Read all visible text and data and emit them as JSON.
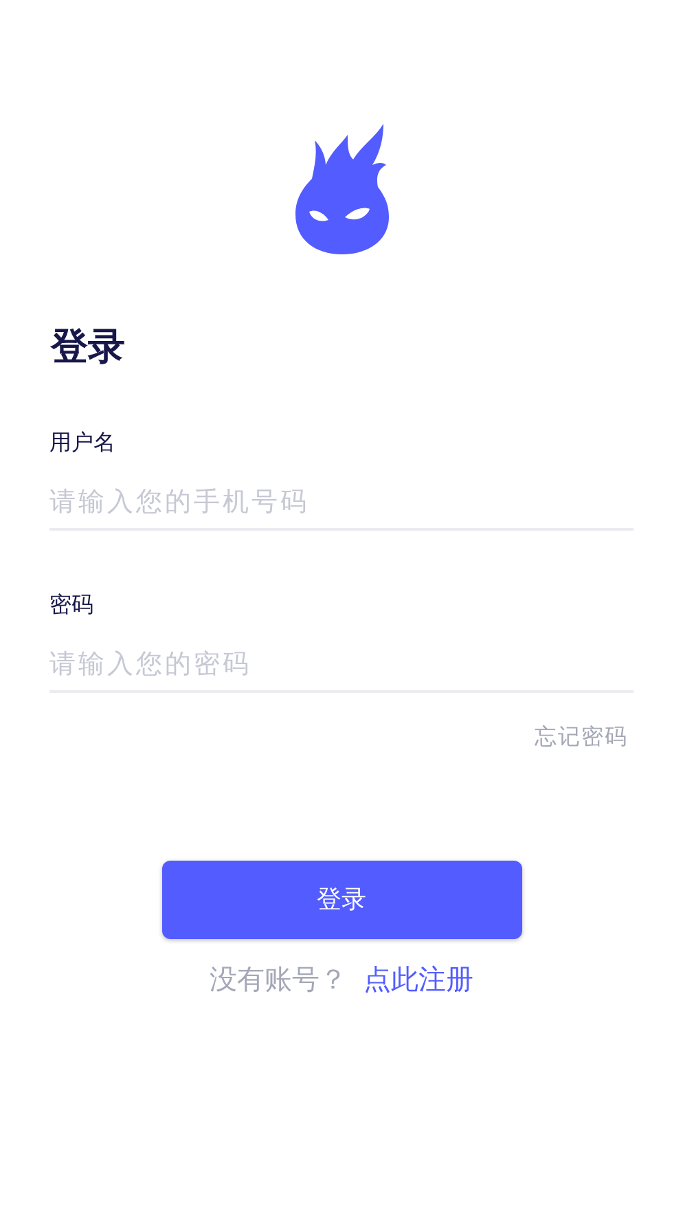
{
  "title": "登录",
  "fields": [
    {
      "label": "用户名",
      "placeholder": "请输入您的手机号码"
    },
    {
      "label": "密码",
      "placeholder": "请输入您的密码"
    }
  ],
  "forgot_link": "忘记密码",
  "login_button": "登录",
  "signup_prompt": "没有账号？",
  "signup_link": "点此注册"
}
